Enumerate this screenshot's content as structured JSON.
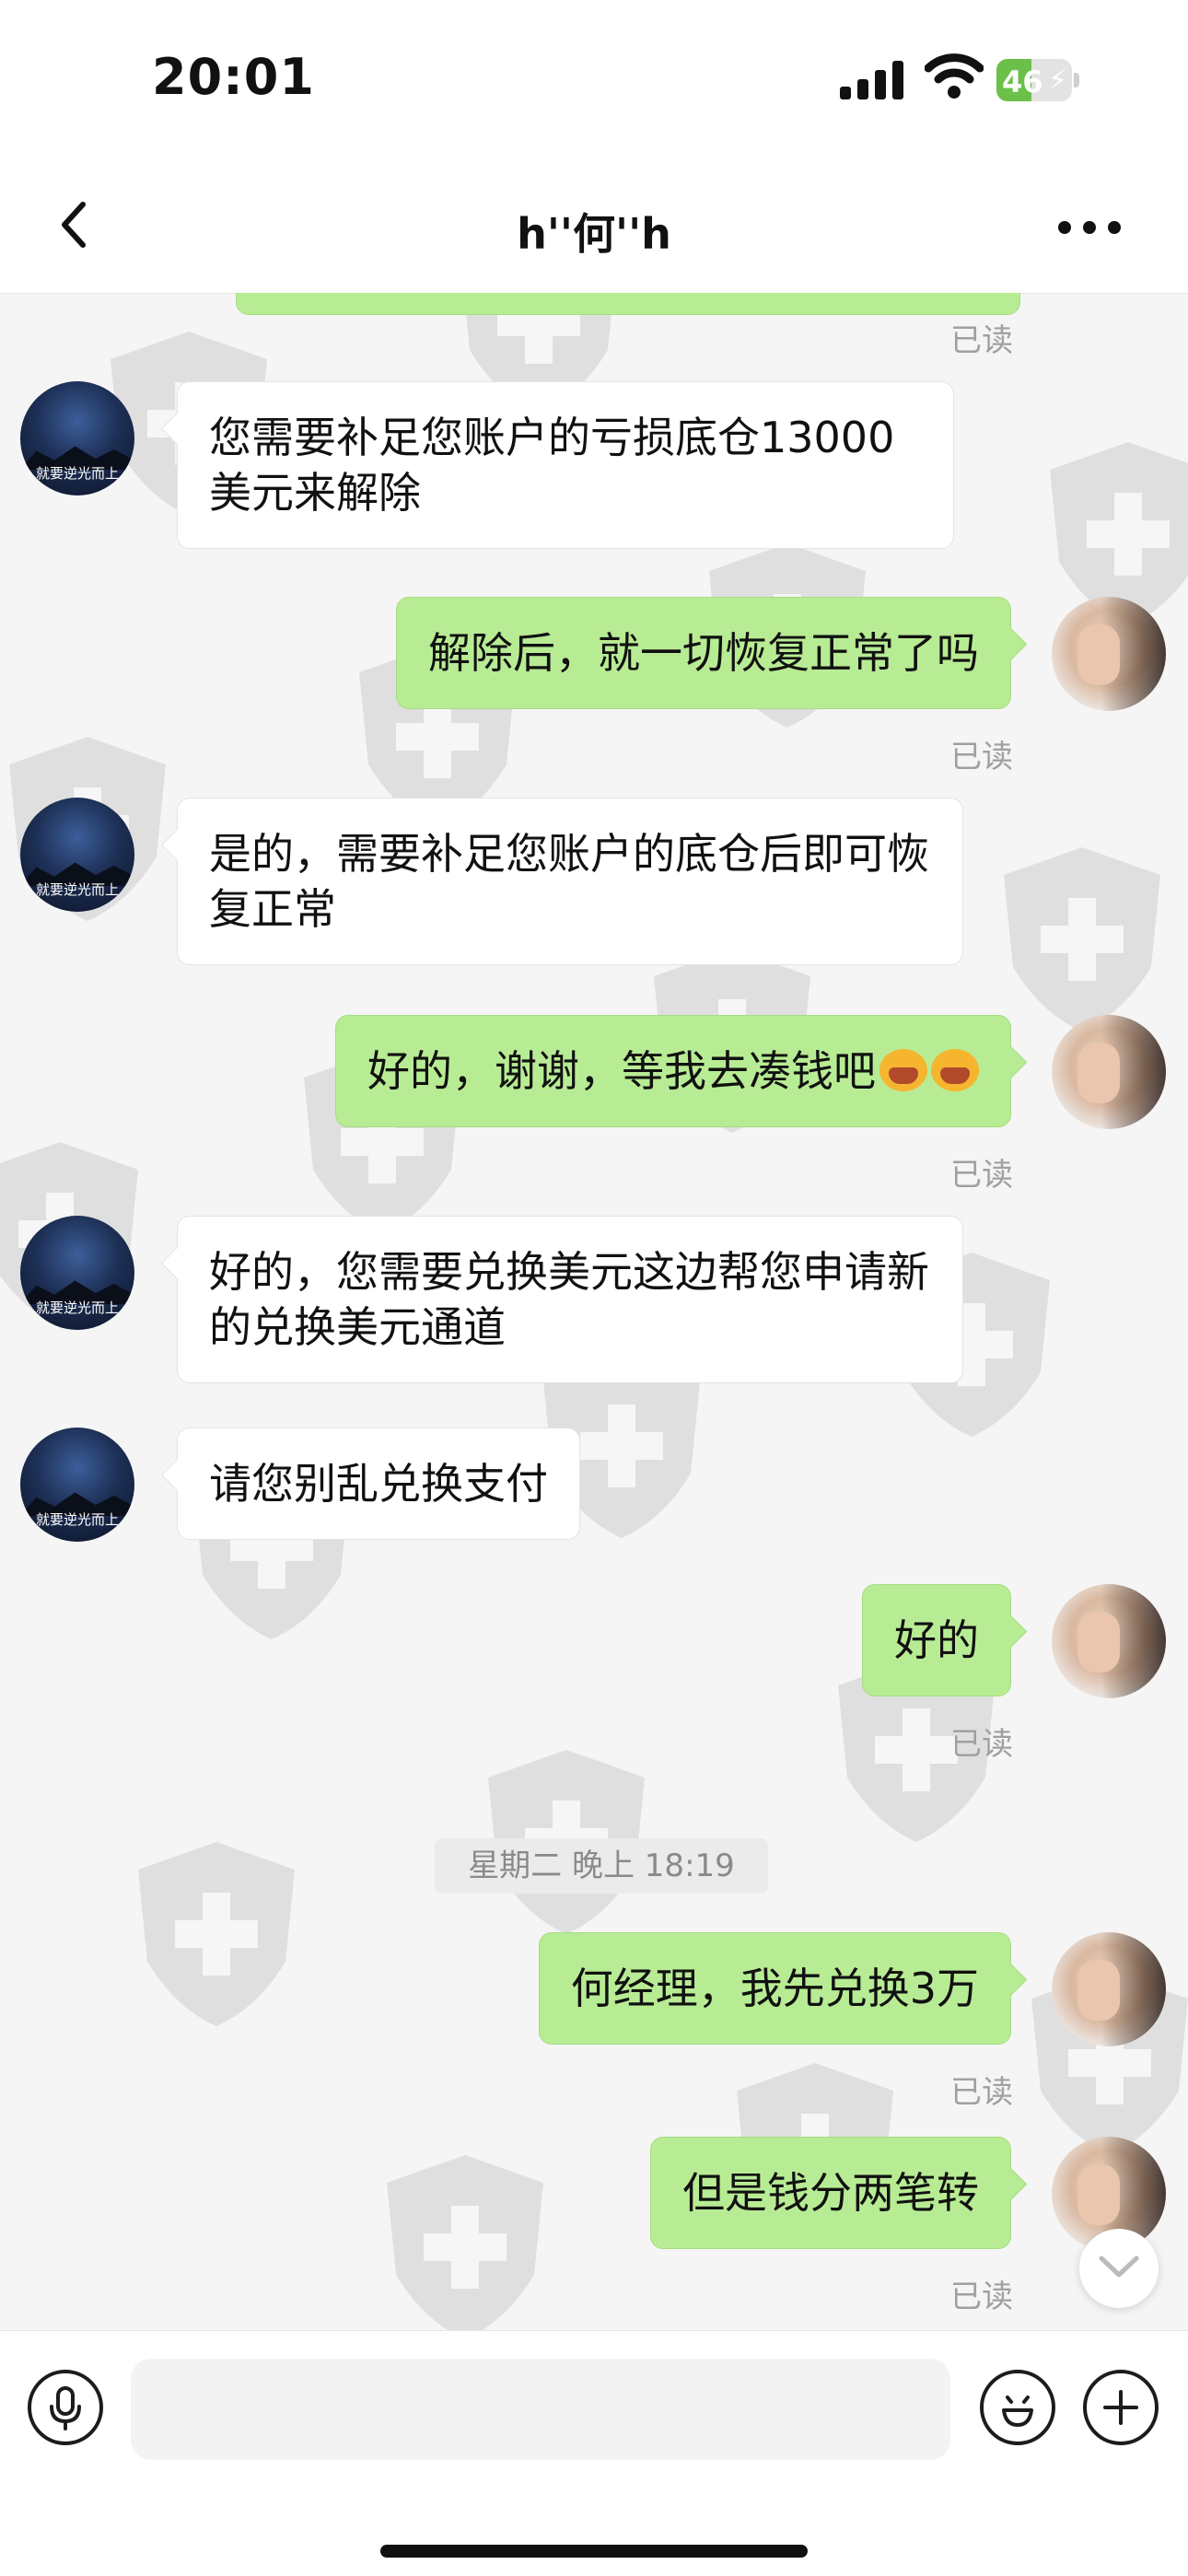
{
  "status_bar": {
    "time": "20:01",
    "battery_level": "46",
    "battery_fraction": 0.46
  },
  "nav": {
    "title": "h''何''h"
  },
  "messages": [
    {
      "from": "me",
      "text": ""
    },
    {
      "read": "已读"
    },
    {
      "from": "them",
      "text": "您需要补足您账户的亏损底仓13000美元来解除"
    },
    {
      "from": "me",
      "text": "解除后，就一切恢复正常了吗",
      "read": "已读"
    },
    {
      "from": "them",
      "text": "是的，需要补足您账户的底仓后即可恢复正常"
    },
    {
      "from": "me",
      "text": "好的，谢谢，等我去凑钱吧",
      "read": "已读"
    },
    {
      "from": "them",
      "text": "好的，您需要兑换美元这边帮您申请新的兑换美元通道"
    },
    {
      "from": "them",
      "text": "请您别乱兑换支付"
    },
    {
      "from": "me",
      "text": "好的",
      "read": "已读"
    },
    {
      "timestamp": "星期二 晚上 18:19"
    },
    {
      "from": "me",
      "text": "何经理，我先兑换3万",
      "read": "已读"
    },
    {
      "from": "me",
      "text": "但是钱分两笔转",
      "read": "已读"
    }
  ],
  "avatar_caption": "就要逆光而上",
  "icons": {
    "back": "chevron-left-icon",
    "more": "more-horizontal-icon",
    "mic": "microphone-icon",
    "emoji": "smiley-icon",
    "plus": "plus-icon",
    "scroll": "chevron-down-icon"
  },
  "colors": {
    "my_bubble": "#b8ec94",
    "their_bubble": "#ffffff",
    "background": "#f5f5f5"
  }
}
